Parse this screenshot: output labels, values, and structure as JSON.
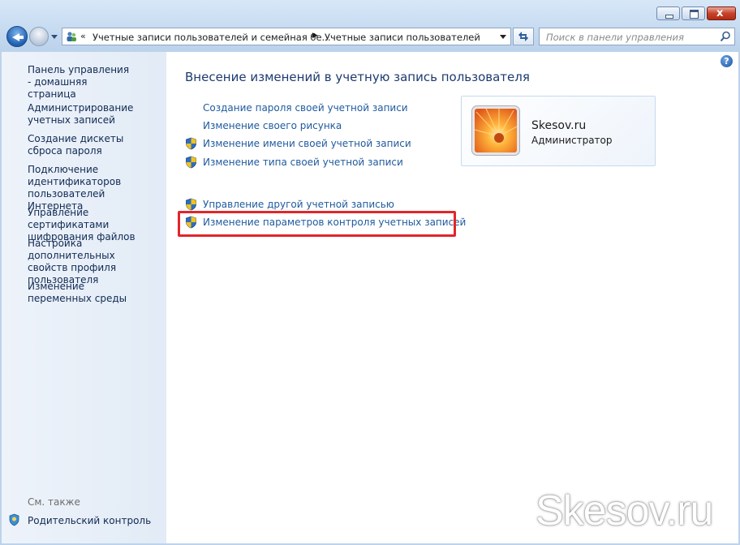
{
  "window": {
    "minimize_icon": "minimize-icon",
    "maximize_icon": "maximize-icon",
    "close_icon": "close-icon",
    "close_glyph": "x"
  },
  "address_bar": {
    "chevrons": "«",
    "crumbs": [
      "Учетные записи пользователей и семейная бе...",
      "Учетные записи пользователей"
    ]
  },
  "search": {
    "placeholder": "Поиск в панели управления"
  },
  "sidebar": {
    "home": "Панель управления - домашняя страница",
    "items": [
      "Администрирование учетных записей",
      "Создание дискеты сброса пароля",
      "Подключение идентификаторов пользователей Интернета",
      "Управление сертификатами шифрования файлов",
      "Настройка дополнительных свойств профиля пользователя",
      "Изменение переменных среды"
    ],
    "see_also": "См. также",
    "parental": "Родительский контроль"
  },
  "main": {
    "heading": "Внесение изменений в учетную запись пользователя",
    "links": [
      "Создание пароля своей учетной записи",
      "Изменение своего рисунка",
      "Изменение имени своей учетной записи",
      "Изменение типа своей учетной записи"
    ],
    "other_links": [
      "Управление другой учетной записью",
      "Изменение параметров контроля учетных записей"
    ]
  },
  "user": {
    "name": "Skesov.ru",
    "role": "Администратор"
  },
  "watermark": "Skesov.ru",
  "help_glyph": "?",
  "colors": {
    "link": "#1f5a9e",
    "highlight": "#e1262a",
    "heading": "#1d3b6e"
  }
}
